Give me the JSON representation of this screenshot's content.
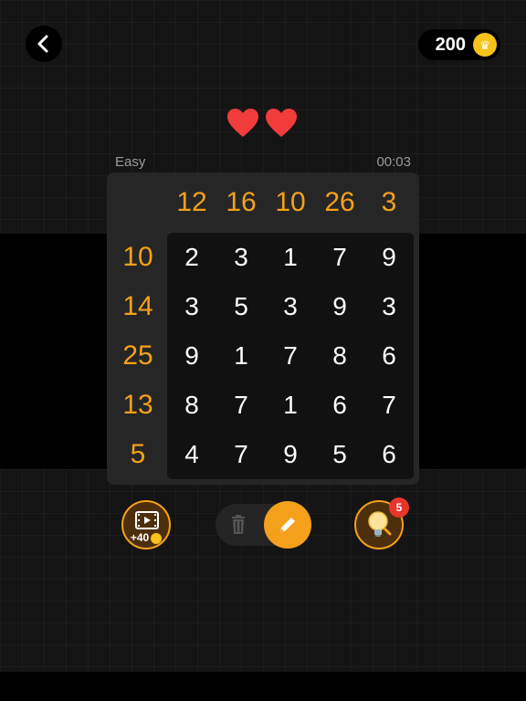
{
  "header": {
    "coins": "200",
    "back_icon": "chevron-left-icon",
    "coin_icon": "crown-coin-icon"
  },
  "status": {
    "lives": 2,
    "difficulty": "Easy",
    "timer": "00:03"
  },
  "puzzle": {
    "column_sums": [
      "12",
      "16",
      "10",
      "26",
      "3"
    ],
    "row_sums": [
      "10",
      "14",
      "25",
      "13",
      "5"
    ],
    "grid": [
      [
        "2",
        "3",
        "1",
        "7",
        "9"
      ],
      [
        "3",
        "5",
        "3",
        "9",
        "3"
      ],
      [
        "9",
        "1",
        "7",
        "8",
        "6"
      ],
      [
        "8",
        "7",
        "1",
        "6",
        "7"
      ],
      [
        "4",
        "7",
        "9",
        "5",
        "6"
      ]
    ]
  },
  "toolbar": {
    "video_reward": "+40",
    "hint_count": "5",
    "video_icon": "film-play-icon",
    "erase_icon": "trash-icon",
    "pencil_icon": "pencil-icon",
    "hint_icon": "lightbulb-icon"
  },
  "colors": {
    "accent": "#f5a01a",
    "heart": "#f23c3c",
    "badge": "#e8352c",
    "coin": "#f7c21a"
  }
}
